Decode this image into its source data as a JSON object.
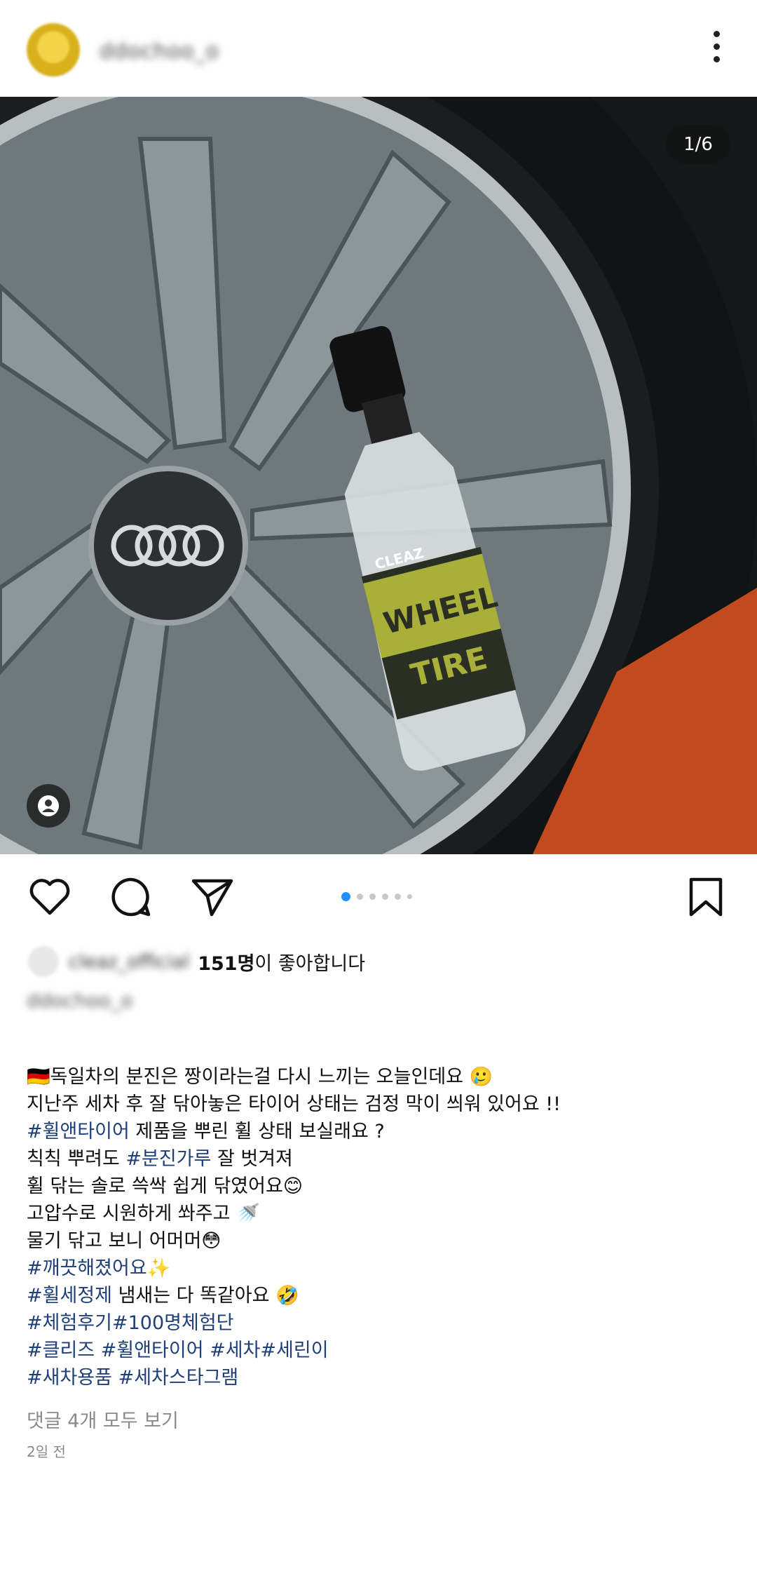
{
  "header": {
    "username": "ddochoo_o",
    "avatar_icon": "profile-avatar",
    "more_icon": "more-vertical-icon"
  },
  "photo": {
    "counter": "1/6",
    "tag_icon": "person-tag-icon"
  },
  "actions": {
    "like_icon": "heart-icon",
    "comment_icon": "comment-icon",
    "share_icon": "send-icon",
    "save_icon": "bookmark-icon",
    "carousel_total": 6,
    "carousel_active": 1,
    "accent": "#1e90ff"
  },
  "likes": {
    "liker": "cleaz_official",
    "count": "151명",
    "suffix": "이 좋아합니다"
  },
  "caption": {
    "username": "ddochoo_o",
    "lines": [
      [
        {
          "t": "🇩🇪독일차의 분진은 짱이라는걸 다시 느끼는 오늘인데요 🥲",
          "h": false
        }
      ],
      [
        {
          "t": "지난주 세차 후 잘 닦아놓은 타이어 상태는 검정 막이 씌워 있어요 !!",
          "h": false
        }
      ],
      [
        {
          "t": "#휠앤타이어",
          "h": true
        },
        {
          "t": " 제품을 뿌린 휠 상태 보실래요 ?",
          "h": false
        }
      ],
      [
        {
          "t": "칙칙 뿌려도 ",
          "h": false
        },
        {
          "t": "#분진가루",
          "h": true
        },
        {
          "t": " 잘 벗겨져",
          "h": false
        }
      ],
      [
        {
          "t": "휠 닦는 솔로  쓱싹 쉽게 닦였어요😊",
          "h": false
        }
      ],
      [
        {
          "t": "고압수로 시원하게 쏴주고 🚿",
          "h": false
        }
      ],
      [
        {
          "t": "물기 닦고 보니 어머머😳",
          "h": false
        }
      ],
      [
        {
          "t": "#깨끗해졌어요",
          "h": true
        },
        {
          "t": "✨",
          "h": false
        }
      ],
      [
        {
          "t": "#휠세정제",
          "h": true
        },
        {
          "t": " 냄새는 다 똑같아요 🤣",
          "h": false
        }
      ],
      [
        {
          "t": "#체험후기#100명체험단",
          "h": true
        }
      ],
      [
        {
          "t": "#클리즈 #휠앤타이어 #세차#세린이",
          "h": true
        }
      ],
      [
        {
          "t": "#새차용품 #세차스타그램",
          "h": true
        }
      ]
    ]
  },
  "comments": "댓글 4개 모두 보기",
  "time": "2일 전"
}
